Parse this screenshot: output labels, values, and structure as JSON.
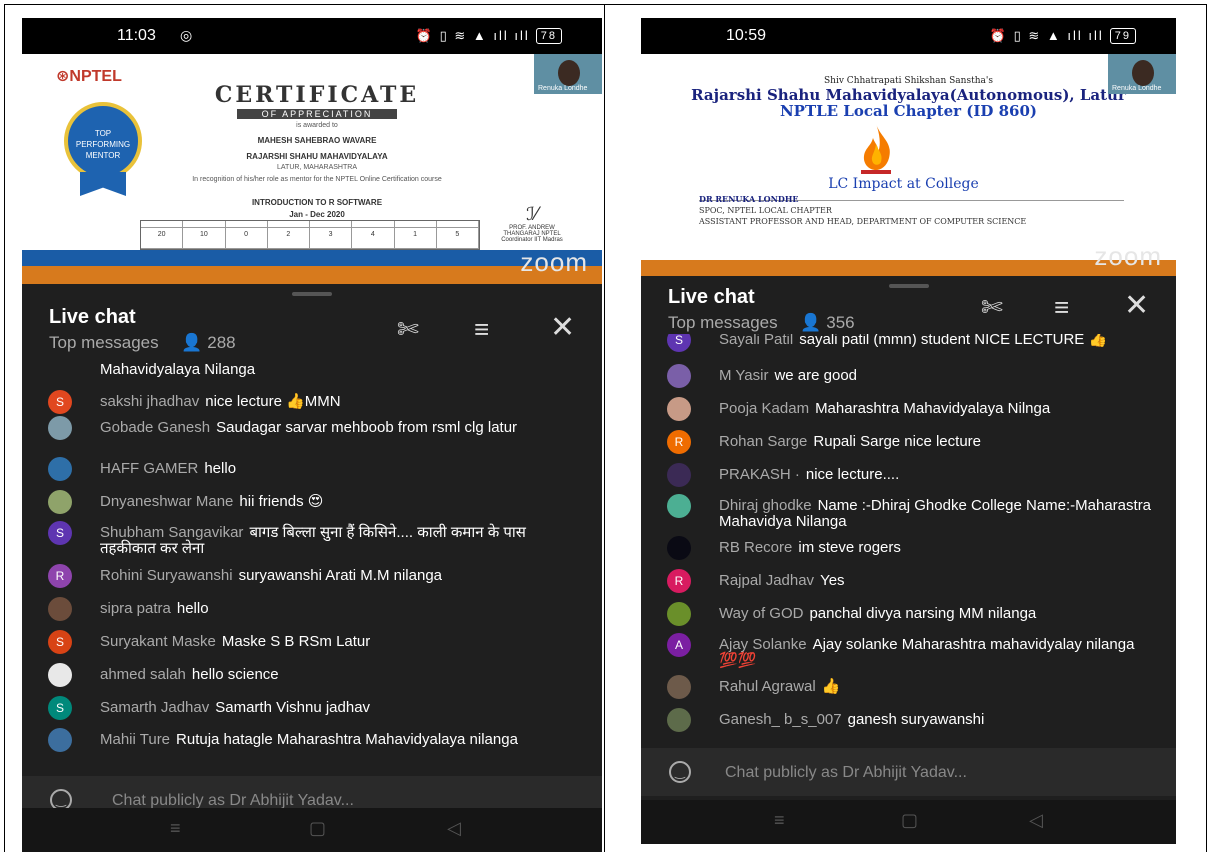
{
  "left": {
    "status": {
      "time": "11:03",
      "battery": "78",
      "icons": "⏰ ▯ ≋ ▲ ıll ıll"
    },
    "video": {
      "brand": "⊛NPTEL",
      "badge": "TOP PERFORMING MENTOR",
      "title": "CERTIFICATE",
      "subtitle": "OF APPRECIATION",
      "awarded": "is awarded to",
      "name": "MAHESH SAHEBRAO WAVARE",
      "college": "RAJARSHI SHAHU MAHAVIDYALAYA",
      "city": "LATUR, MAHARASHTRA",
      "recognition": "In recognition of his/her role as mentor for the NPTEL Online Certification course",
      "course": "INTRODUCTION TO R SOFTWARE",
      "period": "Jan - Dec 2020",
      "table_row": [
        "20",
        "10",
        "0",
        "2",
        "3",
        "4",
        "1",
        "5"
      ],
      "signer": "PROF. ANDREW THANGARAJ NPTEL Coordinator IIT Madras",
      "thumb_name": "Renuka Londhe",
      "zoom": "zoom"
    },
    "chat": {
      "title": "Live chat",
      "subtitle": "Top messages",
      "count": "288",
      "partial_top": "Mahavidyalaya Nilanga",
      "messages": [
        {
          "initial": "S",
          "color": "#e1471f",
          "author": "sakshi jhadhav",
          "text": "nice lecture 👍MMN"
        },
        {
          "initial": "",
          "color": "#7d9aa8",
          "author": "Gobade Ganesh",
          "text": "Saudagar sarvar mehboob from rsml clg latur"
        },
        {
          "initial": "",
          "color": "#2e6fa8",
          "author": "HAFF GAMER",
          "text": "hello"
        },
        {
          "initial": "",
          "color": "#8fa36a",
          "author": "Dnyaneshwar Mane",
          "text": "hii friends 😍"
        },
        {
          "initial": "S",
          "color": "#5e35b1",
          "author": "Shubham Sangavikar",
          "text": "बागड बिल्ला सुना हैं किसिने.... काली कमान के पास तहकीकात कर लेना"
        },
        {
          "initial": "R",
          "color": "#8e44ad",
          "author": "Rohini Suryawanshi",
          "text": "suryawanshi Arati M.M nilanga"
        },
        {
          "initial": "",
          "color": "#6b4c3b",
          "author": "sipra patra",
          "text": "hello"
        },
        {
          "initial": "S",
          "color": "#d84315",
          "author": "Suryakant Maske",
          "text": "Maske S B RSm Latur"
        },
        {
          "initial": "",
          "color": "#e8e8e8",
          "author": "ahmed salah",
          "text": "hello science"
        },
        {
          "initial": "S",
          "color": "#00897b",
          "author": "Samarth Jadhav",
          "text": "Samarth Vishnu jadhav"
        },
        {
          "initial": "",
          "color": "#3c6e9e",
          "author": "Mahii Ture",
          "text": "Rutuja hatagle Maharashtra Mahavidyalaya nilanga"
        }
      ],
      "input_placeholder": "Chat publicly as Dr Abhijit Yadav..."
    },
    "nav": {
      "menu": "≡",
      "home": "▢",
      "back": "◁"
    }
  },
  "right": {
    "status": {
      "time": "10:59",
      "battery": "79",
      "icons": "⏰ ▯ ≋ ▲ ıll ıll"
    },
    "video": {
      "line1": "Shiv Chhatrapati Shikshan Sanstha's",
      "line2": "Rajarshi Shahu Mahavidyalaya(Autonomous), Latur",
      "line3": "NPTLE Local Chapter (ID 860)",
      "impact": "LC Impact at College",
      "person": "DR RENUKA LONDHE",
      "role1": "SPOC, NPTEL LOCAL CHAPTER",
      "role2": "ASSISTANT PROFESSOR AND HEAD, DEPARTMENT OF COMPUTER SCIENCE",
      "thumb_name": "Renuka Londhe",
      "zoom": "zoom"
    },
    "chat": {
      "title": "Live chat",
      "subtitle": "Top messages",
      "count": "356",
      "messages": [
        {
          "initial": "S",
          "color": "#5e35b1",
          "author": "Sayali Patil",
          "text": "sayali patil (mmn) student NICE LECTURE 👍"
        },
        {
          "initial": "",
          "color": "#7a5fa8",
          "author": "M Yasir",
          "text": "we are good"
        },
        {
          "initial": "",
          "color": "#c79a86",
          "author": "Pooja Kadam",
          "text": "Maharashtra Mahavidyalaya Nilnga"
        },
        {
          "initial": "R",
          "color": "#ef6c00",
          "author": "Rohan Sarge",
          "text": "Rupali Sarge nice lecture"
        },
        {
          "initial": "",
          "color": "#3b2a55",
          "author": "PRAKASH ·",
          "text": "nice lecture...."
        },
        {
          "initial": "",
          "color": "#4caf93",
          "author": "Dhiraj ghodke",
          "text": "Name :-Dhiraj Ghodke College Name:-Maharastra Mahavidya Nilanga"
        },
        {
          "initial": "",
          "color": "#0a0a14",
          "author": "RB Recore",
          "text": "im steve rogers"
        },
        {
          "initial": "R",
          "color": "#d81b60",
          "author": "Rajpal Jadhav",
          "text": "Yes"
        },
        {
          "initial": "",
          "color": "#6a8f2a",
          "author": "Way of GOD",
          "text": "panchal divya narsing MM nilanga"
        },
        {
          "initial": "A",
          "color": "#7b1fa2",
          "author": "Ajay Solanke",
          "text": "Ajay solanke Maharashtra mahavidyalay nilanga 💯💯"
        },
        {
          "initial": "",
          "color": "#6d5a4a",
          "author": "Rahul Agrawal",
          "text": "👍"
        },
        {
          "initial": "",
          "color": "#5d6b4a",
          "author": "Ganesh_ b_s_007",
          "text": "ganesh suryawanshi"
        }
      ],
      "input_placeholder": "Chat publicly as Dr Abhijit Yadav..."
    },
    "nav": {
      "menu": "≡",
      "home": "▢",
      "back": "◁"
    }
  }
}
